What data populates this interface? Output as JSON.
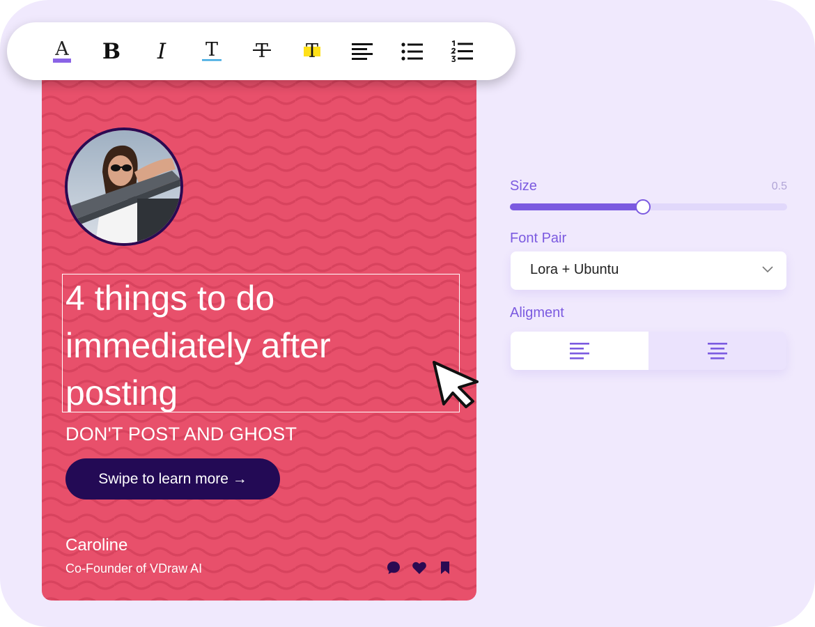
{
  "toolbar": {
    "buttons": [
      {
        "name": "text-color",
        "glyph": "A"
      },
      {
        "name": "bold",
        "glyph": "B"
      },
      {
        "name": "italic",
        "glyph": "I"
      },
      {
        "name": "underline",
        "glyph": "T"
      },
      {
        "name": "strikethrough",
        "glyph": "T"
      },
      {
        "name": "highlight",
        "glyph": "T"
      },
      {
        "name": "align-left",
        "glyph": ""
      },
      {
        "name": "bullet-list",
        "glyph": ""
      },
      {
        "name": "numbered-list",
        "glyph": ""
      }
    ],
    "text_color_accent": "#8a63e6",
    "underline_accent": "#3fa9e0",
    "highlight_accent": "#ffe019"
  },
  "card": {
    "background_color": "#e8506b",
    "headline_lines": [
      "4 things to do",
      "immediately after",
      "posting"
    ],
    "subheading": "DON'T POST AND GHOST",
    "cta_label": "Swipe to learn more →",
    "author_name": "Caroline",
    "author_role": "Co-Founder of VDraw AI",
    "action_icons": [
      "comment-icon",
      "heart-icon",
      "bookmark-icon"
    ]
  },
  "panel": {
    "size_label": "Size",
    "size_value": "0.5",
    "size_fraction": 0.48,
    "font_pair_label": "Font Pair",
    "font_pair_value": "Lora + Ubuntu",
    "alignment_label": "Aligment",
    "alignment_options": [
      "left",
      "center"
    ],
    "alignment_selected": "left",
    "accent_color": "#7b5ae0"
  }
}
